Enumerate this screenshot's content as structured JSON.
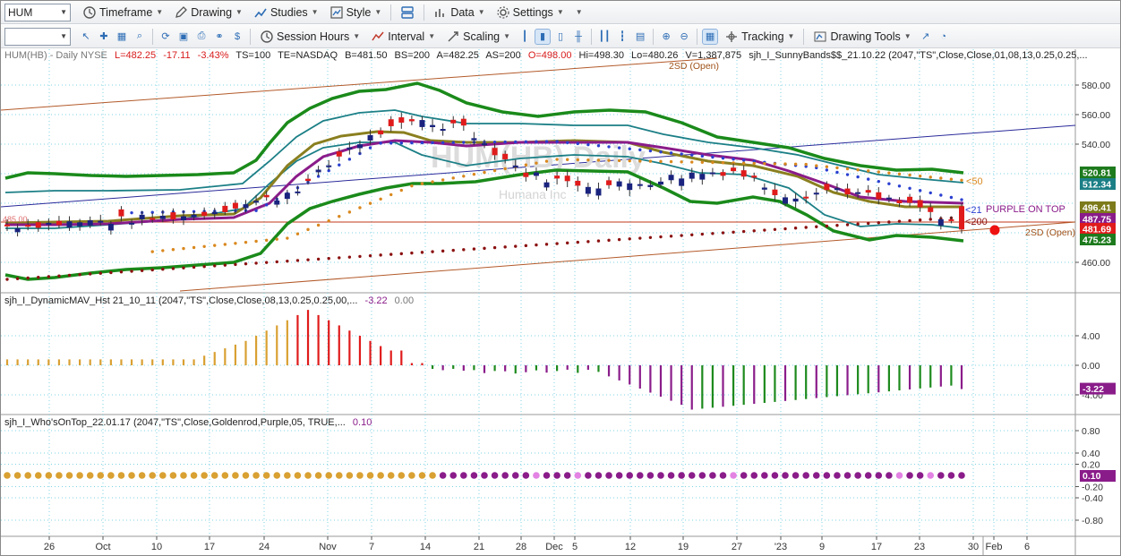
{
  "toolbar1": {
    "symbol": "HUM",
    "timeframe": "Timeframe",
    "drawing": "Drawing",
    "studies": "Studies",
    "style": "Style",
    "data": "Data",
    "settings": "Settings"
  },
  "toolbar2": {
    "session_hours": "Session Hours",
    "interval": "Interval",
    "scaling": "Scaling",
    "tracking": "Tracking",
    "drawing_tools": "Drawing Tools"
  },
  "price_pane": {
    "header": {
      "symbol": "HUM(HB) - Daily  NYSE",
      "last": "L=482.25",
      "change": "-17.11",
      "change_pct": "-3.43%",
      "ts": "TS=100",
      "te": "TE=NASDAQ",
      "bid": "B=481.50",
      "bid_size": "BS=200",
      "ask": "A=482.25",
      "ask_size": "AS=200",
      "open": "O=498.00",
      "high": "Hi=498.30",
      "low": "Lo=480.26",
      "volume": "V=1,387,875",
      "study": "sjh_I_SunnyBands$$_21.10.22 (2047,\"TS\",Close,Close,01,08,13,0.25,0.25,..."
    },
    "watermark": "HUM(HB) Daily",
    "watermark_sub": "Humana Inc",
    "annotations": {
      "sd_open_top": "2SD (Open)",
      "sd_open_right": "2SD (Open)",
      "lt50": "<50",
      "lt21": "<21",
      "lt200": "<200",
      "purple_on_top": "PURPLE ON TOP",
      "left_price": "485.00"
    },
    "axis_ticks": [
      "580.00",
      "560.00",
      "540.00",
      "460.00"
    ],
    "price_tags": [
      {
        "value": "520.81",
        "color": "#1d7a1d"
      },
      {
        "value": "512.34",
        "color": "#1b7f86"
      },
      {
        "value": "496.41",
        "color": "#7c7a1a"
      },
      {
        "value": "487.75",
        "color": "#8a1c8a"
      },
      {
        "value": "481.69",
        "color": "#e01b1b"
      },
      {
        "value": "475.23",
        "color": "#1d7a1d"
      }
    ]
  },
  "mav_pane": {
    "title": "sjh_I_DynamicMAV_Hst 21_10_11 (2047,\"TS\",Close,Close,08,13,0.25,0.25,00,...",
    "value1": "-3.22",
    "value2": "0.00",
    "axis_ticks": [
      "4.00",
      "0.00",
      "-4.00"
    ],
    "tag": "-3.22",
    "tag_color": "#8a1c8a"
  },
  "who_pane": {
    "title": "sjh_I_Who'sOnTop_22.01.17 (2047,\"TS\",Close,Goldenrod,Purple,05, TRUE,...",
    "value": "0.10",
    "axis_ticks": [
      "0.80",
      "0.40",
      "0.20",
      "-0.20",
      "-0.40",
      "-0.80"
    ],
    "tag": "0.10",
    "tag_color": "#8a1c8a"
  },
  "time_axis": [
    "26",
    "Oct",
    "10",
    "17",
    "24",
    "Nov",
    "7",
    "14",
    "21",
    "28",
    "Dec",
    "5",
    "12",
    "19",
    "27",
    "'23",
    "9",
    "17",
    "23",
    "30",
    "Feb",
    "6"
  ],
  "colors": {
    "up_candle": "#1a237e",
    "down_candle": "#e01b1b",
    "band_green": "#1a8a1a",
    "band_teal": "#1b7f86",
    "ma_olive": "#8a7f1f",
    "ma_purple": "#8a1c8a",
    "dots_blue": "#2a3fd0",
    "dots_orange": "#d9881e",
    "dots_darkred": "#8b1010",
    "hist_gold": "#d9a032",
    "hist_red": "#e01b1b",
    "hist_purple": "#8a1c8a",
    "hist_green": "#1d8a1d"
  }
}
